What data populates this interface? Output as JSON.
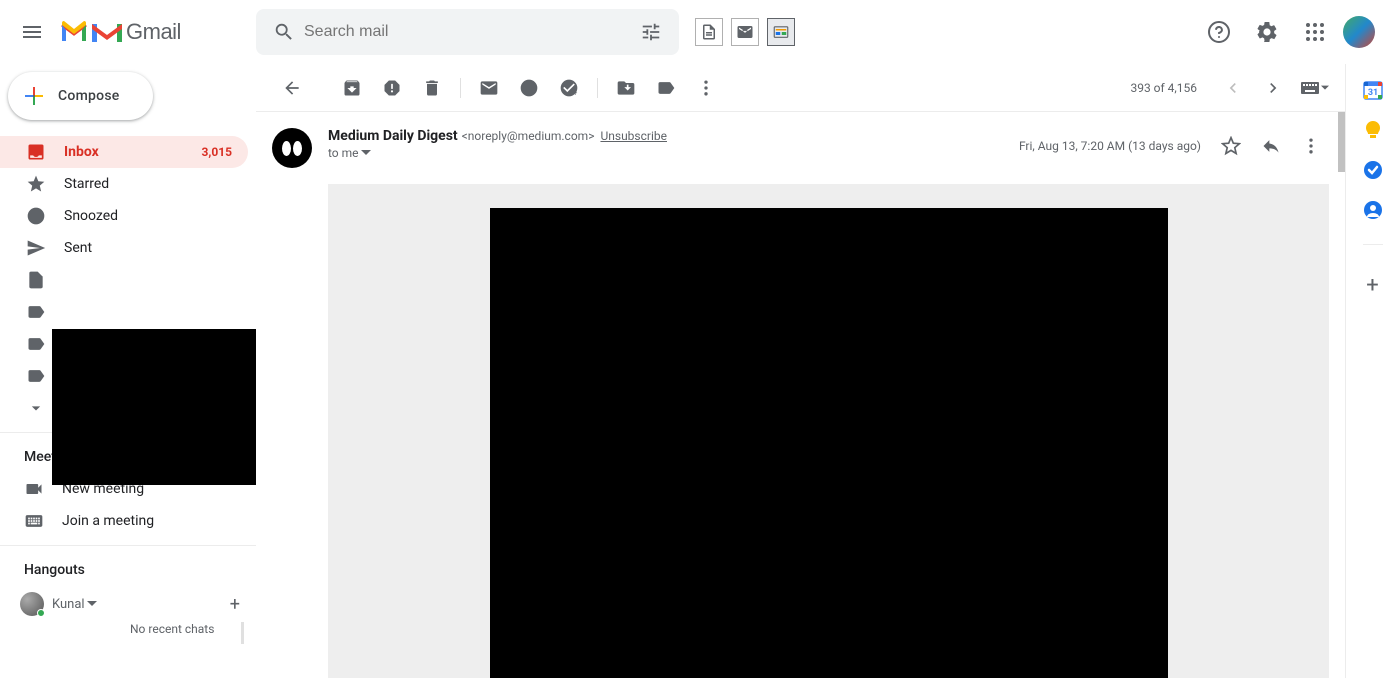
{
  "header": {
    "brand": "Gmail",
    "search_placeholder": "Search mail"
  },
  "compose_label": "Compose",
  "sidebar": {
    "items": [
      {
        "label": "Inbox",
        "count": "3,015"
      },
      {
        "label": "Starred"
      },
      {
        "label": "Snoozed"
      },
      {
        "label": "Sent"
      }
    ]
  },
  "meet": {
    "title": "Meet",
    "new_meeting": "New meeting",
    "join_meeting": "Join a meeting"
  },
  "hangouts": {
    "title": "Hangouts",
    "user": "Kunal",
    "no_chats": "No recent chats"
  },
  "toolbar": {
    "pager": "393 of 4,156"
  },
  "message": {
    "sender_name": "Medium Daily Digest",
    "sender_email": "<noreply@medium.com>",
    "unsubscribe": "Unsubscribe",
    "to": "to me",
    "date": "Fri, Aug 13, 7:20 AM (13 days ago)"
  },
  "icons": {
    "menu": "menu-icon",
    "search": "search-icon",
    "tune": "tune-icon"
  }
}
